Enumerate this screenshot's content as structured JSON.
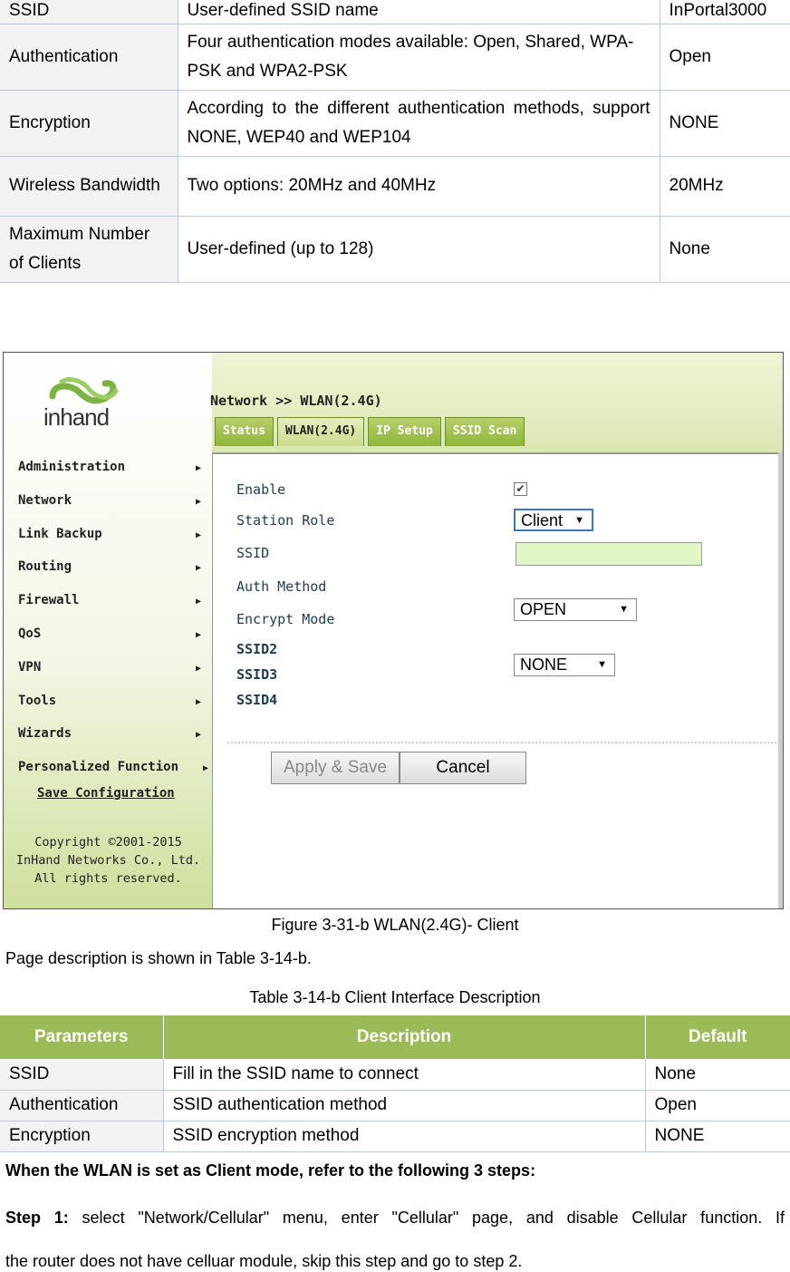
{
  "top_table": {
    "rows": [
      {
        "param": "SSID",
        "desc": "User-defined SSID name",
        "default": "InPortal3000"
      },
      {
        "param": "Authentication",
        "desc": "Four authentication modes available: Open, Shared, WPA-PSK and WPA2-PSK",
        "default": "Open"
      },
      {
        "param": "Encryption",
        "desc": "According to the different authentication methods, support NONE, WEP40 and WEP104",
        "default": "NONE"
      },
      {
        "param": "Wireless Bandwidth",
        "desc": "Two options: 20MHz and 40MHz",
        "default": "20MHz"
      },
      {
        "param": "Maximum Number of Clients",
        "desc": "User-defined (up to 128)",
        "default": "None"
      }
    ]
  },
  "screenshot": {
    "logo_text": "inhand",
    "breadcrumb": "Network >> WLAN(2.4G)",
    "tabs": [
      "Status",
      "WLAN(2.4G)",
      "IP Setup",
      "SSID Scan"
    ],
    "menu": [
      "Administration",
      "Network",
      "Link Backup",
      "Routing",
      "Firewall",
      "QoS",
      "VPN",
      "Tools",
      "Wizards",
      "Personalized Function"
    ],
    "save_configuration": "Save Configuration",
    "copyright": [
      "Copyright ©2001-2015",
      "InHand Networks Co., Ltd.",
      "All rights reserved."
    ],
    "form": {
      "enable_label": "Enable",
      "enable_checked": "✔",
      "station_role_label": "Station Role",
      "station_role_value": "Client",
      "ssid_label": "SSID",
      "ssid_value": "",
      "auth_label": "Auth Method",
      "auth_value": "OPEN",
      "encrypt_label": "Encrypt Mode",
      "encrypt_value": "NONE",
      "ssid2": "SSID2",
      "ssid3": "SSID3",
      "ssid4": "SSID4",
      "apply_label": "Apply & Save",
      "cancel_label": "Cancel"
    },
    "arrow_glyph": "▶",
    "dropdown_glyph": "▼",
    "colors": {
      "menu_green": "#c5d888",
      "tab_green": "#8fb43a",
      "ssid_input": "#dff7c4"
    }
  },
  "figure_caption": "Figure 3-31-b WLAN(2.4G)- Client",
  "page_desc": "Page description is shown in Table 3-14-b.",
  "table_caption": "Table 3-14-b Client Interface Description",
  "bottom_table": {
    "headers": [
      "Parameters",
      "Description",
      "Default"
    ],
    "rows": [
      {
        "param": "SSID",
        "desc": "Fill in the SSID name to connect",
        "default": "None"
      },
      {
        "param": "Authentication",
        "desc": "SSID authentication method",
        "default": "Open"
      },
      {
        "param": "Encryption",
        "desc": "SSID encryption method",
        "default": "NONE"
      }
    ]
  },
  "client_mode_heading": "When the WLAN is set as Client mode, refer to the following 3 steps:",
  "step1_label": "Step 1:",
  "step1_text": "select \"Network/Cellular\" menu, enter \"Cellular\" page, and disable Cellular function. If",
  "step1_cont": "the router does not have celluar module, skip this step and go to step 2."
}
